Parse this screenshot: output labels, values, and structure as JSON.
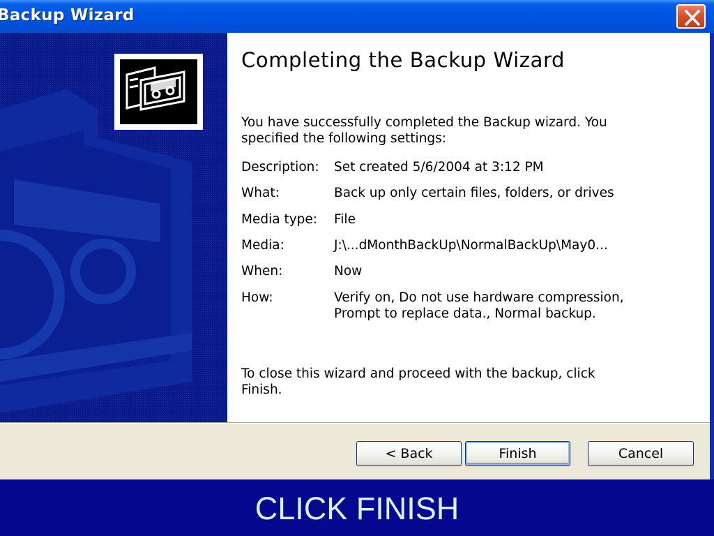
{
  "window": {
    "title": "Backup Wizard",
    "close_icon": "close-icon"
  },
  "colors": {
    "titlebar": "#0055e5",
    "side_panel": "#0a1a8a",
    "button_bar": "#ece9d8",
    "close_button": "#d8522c",
    "footer": "#05098e",
    "footer_text": "#d8f0ff"
  },
  "wizard": {
    "heading": "Completing the Backup Wizard",
    "intro_line1": "You have successfully completed the Backup wizard. You",
    "intro_line2": "specified the following settings:",
    "settings": [
      {
        "label": "Description:",
        "value": "Set created 5/6/2004 at 3:12 PM"
      },
      {
        "label": "What:",
        "value": "Back up only certain files, folders, or drives"
      },
      {
        "label": "Media type:",
        "value": "File"
      },
      {
        "label": "Media:",
        "value": "J:\\...dMonthBackUp\\NormalBackUp\\May0..."
      },
      {
        "label": "When:",
        "value": "Now"
      },
      {
        "label": "How:",
        "value": "Verify on, Do not use hardware compression,",
        "value_line2": "Prompt to replace data., Normal backup."
      }
    ],
    "closing_line1": "To close this wizard and proceed with the backup, click",
    "closing_line2": "Finish.",
    "logo_icon": "backup-tape-icon"
  },
  "buttons": {
    "back": "< Back",
    "finish": "Finish",
    "cancel": "Cancel"
  },
  "footer": {
    "caption": "CLICK FINISH"
  }
}
